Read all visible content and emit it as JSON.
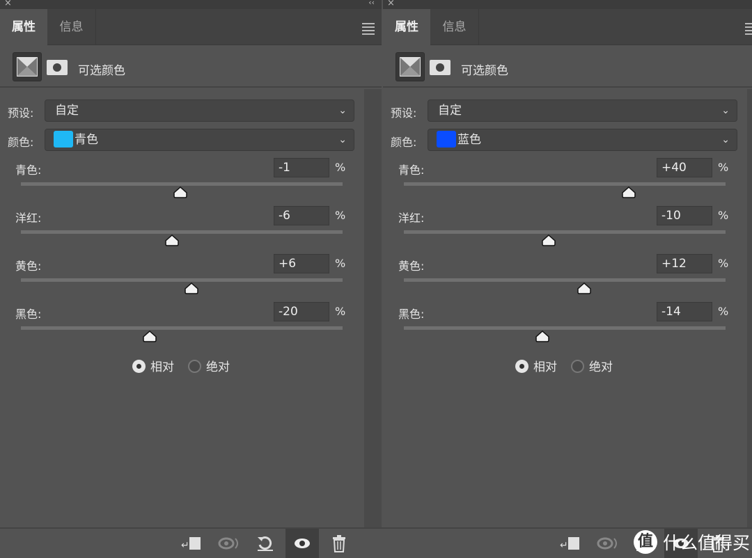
{
  "panels": [
    {
      "tabs": [
        "属性",
        "信息"
      ],
      "adjustment_title": "可选颜色",
      "preset_label": "预设:",
      "preset_value": "自定",
      "color_label": "颜色:",
      "color_value": "青色",
      "color_swatch": "#1fb8f5",
      "sliders": [
        {
          "label": "青色:",
          "value": "-1",
          "unit": "%",
          "numeric": -1
        },
        {
          "label": "洋红:",
          "value": "-6",
          "unit": "%",
          "numeric": -6
        },
        {
          "label": "黄色:",
          "value": "+6",
          "unit": "%",
          "numeric": 6
        },
        {
          "label": "黑色:",
          "value": "-20",
          "unit": "%",
          "numeric": -20
        }
      ],
      "slider_range": [
        -100,
        100
      ],
      "method_options": [
        "相对",
        "绝对"
      ],
      "method_selected": "相对"
    },
    {
      "tabs": [
        "属性",
        "信息"
      ],
      "adjustment_title": "可选颜色",
      "preset_label": "预设:",
      "preset_value": "自定",
      "color_label": "颜色:",
      "color_value": "蓝色",
      "color_swatch": "#0a4dff",
      "sliders": [
        {
          "label": "青色:",
          "value": "+40",
          "unit": "%",
          "numeric": 40
        },
        {
          "label": "洋红:",
          "value": "-10",
          "unit": "%",
          "numeric": -10
        },
        {
          "label": "黄色:",
          "value": "+12",
          "unit": "%",
          "numeric": 12
        },
        {
          "label": "黑色:",
          "value": "-14",
          "unit": "%",
          "numeric": -14
        }
      ],
      "slider_range": [
        -100,
        100
      ],
      "method_options": [
        "相对",
        "绝对"
      ],
      "method_selected": "相对"
    }
  ],
  "bottom_icons": [
    "clip-to-layer-icon",
    "view-previous-state-icon",
    "reset-icon",
    "visibility-eye-icon",
    "trash-icon"
  ],
  "watermark": "什么值得买",
  "watermark_logo": "值"
}
